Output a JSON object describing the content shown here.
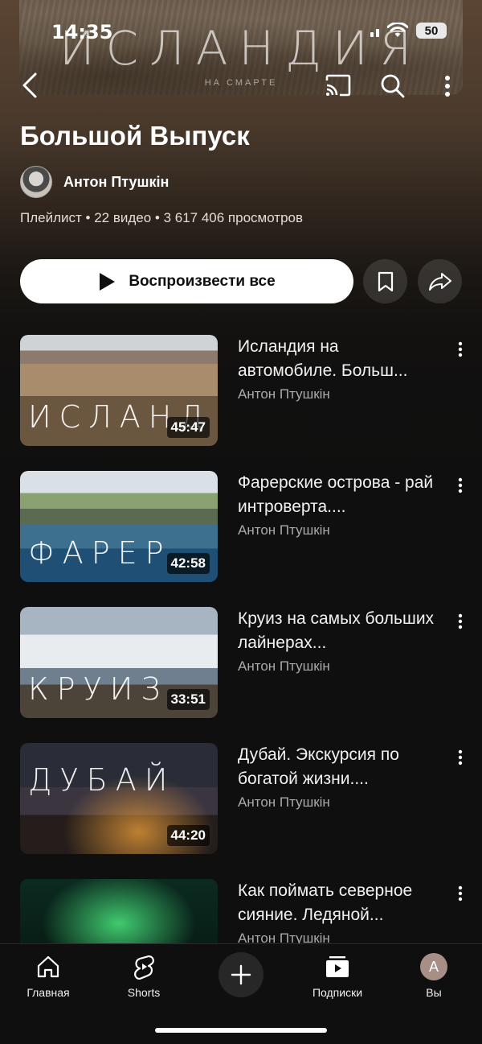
{
  "status_bar": {
    "time": "14:35",
    "battery": "50"
  },
  "banner": {
    "title": "ИСЛАНДИЯ",
    "subtitle": "НА СМАРТЕ"
  },
  "playlist": {
    "title": "Большой Выпуск",
    "author": "Антон Птушкін",
    "meta": "Плейлист • 22 видео • 3 617 406 просмотров",
    "play_all_label": "Воспроизвести все"
  },
  "videos": [
    {
      "title": "Исландия на автомобиле. Больш...",
      "author": "Антон Птушкін",
      "duration": "45:47",
      "thumb_text": "ИСЛАНД"
    },
    {
      "title": "Фарерские острова - рай интроверта....",
      "author": "Антон Птушкін",
      "duration": "42:58",
      "thumb_text": "ФАРЕР"
    },
    {
      "title": "Круиз на самых больших лайнерах...",
      "author": "Антон Птушкін",
      "duration": "33:51",
      "thumb_text": "КРУИЗ"
    },
    {
      "title": "Дубай. Экскурсия по богатой жизни....",
      "author": "Антон Птушкін",
      "duration": "44:20",
      "thumb_text": "ДУБАЙ"
    },
    {
      "title": "Как поймать северное сияние. Ледяной...",
      "author": "Антон Птушкін",
      "duration": "",
      "thumb_text": ""
    }
  ],
  "nav": {
    "home": "Главная",
    "shorts": "Shorts",
    "subscriptions": "Подписки",
    "you": "Вы",
    "profile_initial": "A"
  },
  "colors": {
    "accent": "#ffffff",
    "background": "#0f0f0f",
    "secondary_text": "#aaaaaa"
  }
}
